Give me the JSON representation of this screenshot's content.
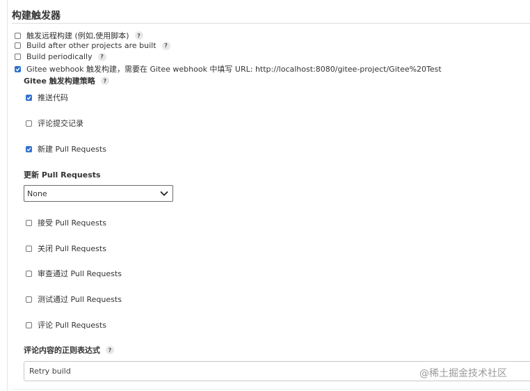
{
  "section": {
    "title": "构建触发器"
  },
  "triggers": [
    {
      "label": "触发远程构建 (例如,使用脚本)",
      "checked": false,
      "help": "?"
    },
    {
      "label": "Build after other projects are built",
      "checked": false,
      "help": "?"
    },
    {
      "label": "Build periodically",
      "checked": false,
      "help": "?"
    },
    {
      "label": "Gitee webhook 触发构建，需要在 Gitee webhook 中填写 URL: http://localhost:8080/gitee-project/Gitee%20Test",
      "checked": true
    }
  ],
  "gitee": {
    "strategy_title": "Gitee 触发构建策略",
    "strategy_help": "?",
    "options": [
      {
        "label": "推送代码",
        "checked": true
      },
      {
        "label": "评论提交记录",
        "checked": false
      },
      {
        "label": "新建 Pull Requests",
        "checked": true
      }
    ],
    "update_pr": {
      "title": "更新 Pull Requests",
      "selected": "None"
    },
    "pr_options": [
      {
        "label": "接受 Pull Requests",
        "checked": false
      },
      {
        "label": "关闭 Pull Requests",
        "checked": false
      },
      {
        "label": "审查通过 Pull Requests",
        "checked": false
      },
      {
        "label": "测试通过 Pull Requests",
        "checked": false
      },
      {
        "label": "评论 Pull Requests",
        "checked": false
      }
    ],
    "comment_regex": {
      "title": "评论内容的正则表达式",
      "help": "?",
      "value": "Retry build"
    }
  },
  "watermark": "@稀土掘金技术社区",
  "colors": {
    "checkbox_checked": "#2f6fd1",
    "text": "#333333"
  }
}
